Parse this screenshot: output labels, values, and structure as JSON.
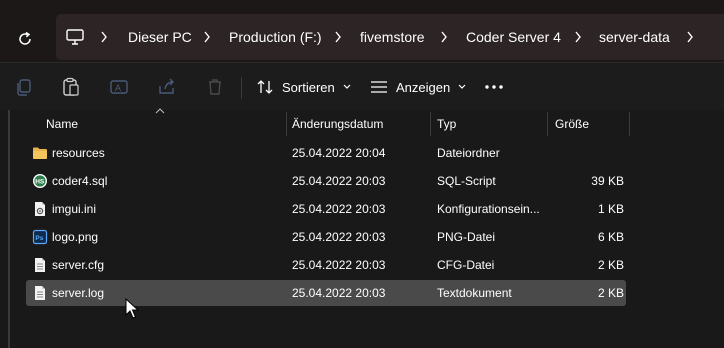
{
  "address_bar": {
    "breadcrumbs": [
      "Dieser PC",
      "Production (F:)",
      "fivemstore",
      "Coder Server 4",
      "server-data"
    ]
  },
  "toolbar": {
    "sort_label": "Sortieren",
    "view_label": "Anzeigen"
  },
  "columns": {
    "name": "Name",
    "date": "Änderungsdatum",
    "type": "Typ",
    "size": "Größe"
  },
  "files": [
    {
      "name": "resources",
      "date": "25.04.2022 20:04",
      "type": "Dateiordner",
      "size": "",
      "icon": "folder-icon"
    },
    {
      "name": "coder4.sql",
      "date": "25.04.2022 20:03",
      "type": "SQL-Script",
      "size": "39 KB",
      "icon": "sql-file-icon"
    },
    {
      "name": "imgui.ini",
      "date": "25.04.2022 20:03",
      "type": "Konfigurationsein...",
      "size": "1 KB",
      "icon": "config-file-icon"
    },
    {
      "name": "logo.png",
      "date": "25.04.2022 20:03",
      "type": "PNG-Datei",
      "size": "6 KB",
      "icon": "png-file-icon"
    },
    {
      "name": "server.cfg",
      "date": "25.04.2022 20:03",
      "type": "CFG-Datei",
      "size": "2 KB",
      "icon": "document-icon"
    },
    {
      "name": "server.log",
      "date": "25.04.2022 20:03",
      "type": "Textdokument",
      "size": "2 KB",
      "icon": "document-icon"
    }
  ],
  "selected_file": "server.log",
  "colors": {
    "background": "#191919",
    "topbar": "#1c1818",
    "address_bar": "#2d2525",
    "selected_row": "#4a4a4a",
    "folder": "#e8b34a"
  }
}
